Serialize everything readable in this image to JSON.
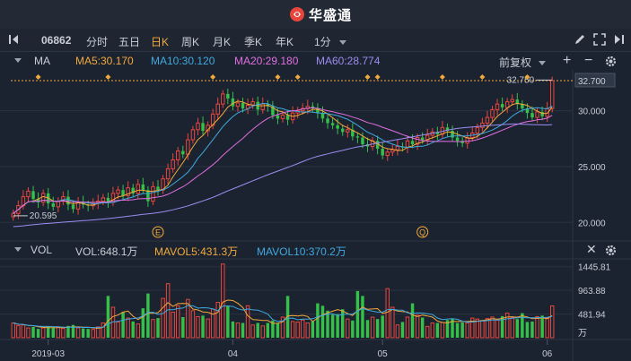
{
  "app": {
    "logo_text": "华盛通"
  },
  "toolbar": {
    "stock_code": "06862",
    "tabs": [
      "分时",
      "五日",
      "日K",
      "周K",
      "月K",
      "季K",
      "年K"
    ],
    "active_tab": "日K",
    "interval": "1分"
  },
  "ma_panel": {
    "title": "MA",
    "ma5": "MA5:30.170",
    "ma10": "MA10:30.120",
    "ma20": "MA20:29.180",
    "ma60": "MA60:28.774",
    "adjust": "前复权",
    "price_axis": [
      "32.700",
      "30.000",
      "25.000",
      "20.000"
    ],
    "high_label": "32.750",
    "low_label": "20.595",
    "event_markers": [
      "E",
      "Q"
    ]
  },
  "vol_panel": {
    "title": "VOL",
    "vol": "VOL:648.1万",
    "mavol5": "MAVOL5:431.3万",
    "mavol10": "MAVOL10:370.2万",
    "axis": [
      "1445.81",
      "963.88",
      "481.94",
      "万"
    ]
  },
  "time_axis": [
    "2019-03",
    "04",
    "05",
    "06"
  ],
  "colors": {
    "up": "#e8463d",
    "down": "#35c04a",
    "ma5": "#f2a93b",
    "ma10": "#3fa9e0",
    "ma20": "#e06ee0",
    "ma60": "#9b8cf0",
    "accent": "#f2a93b"
  },
  "chart_data": {
    "type": "candlestick",
    "price_range": [
      18.5,
      33.5
    ],
    "vol_range": [
      0,
      1550
    ],
    "close": [
      20.8,
      21.5,
      22.3,
      22.8,
      22.1,
      21.8,
      22.6,
      21.7,
      21.4,
      21.9,
      22.3,
      21.6,
      21.2,
      21.8,
      21.6,
      21.5,
      21.7,
      21.9,
      22.2,
      21.8,
      22.6,
      22.9,
      22.4,
      23.1,
      22.6,
      23.4,
      22.9,
      21.9,
      23.2,
      22.9,
      23.9,
      24.8,
      25.6,
      26.4,
      26.1,
      27.4,
      28.3,
      28.9,
      28.2,
      28.7,
      29.7,
      30.6,
      31.5,
      31.1,
      30.4,
      30.7,
      30.2,
      30.5,
      30.8,
      30.1,
      30.6,
      30.4,
      29.6,
      29.3,
      29.6,
      29.2,
      29.8,
      30.0,
      30.2,
      30.4,
      30.2,
      29.8,
      29.3,
      28.9,
      28.7,
      28.4,
      28.1,
      28.3,
      27.7,
      27.6,
      27.0,
      26.8,
      27.3,
      26.6,
      26.0,
      26.3,
      26.5,
      26.8,
      26.7,
      27.3,
      27.0,
      27.6,
      27.4,
      27.8,
      28.1,
      27.9,
      28.5,
      28.2,
      27.6,
      27.3,
      27.1,
      27.6,
      28.0,
      28.5,
      28.9,
      29.4,
      30.1,
      30.6,
      30.3,
      30.8,
      31.0,
      30.6,
      30.2,
      29.8,
      29.4,
      29.9,
      29.5,
      30.2,
      32.7
    ],
    "vol": [
      300,
      250,
      260,
      200,
      220,
      180,
      200,
      230,
      200,
      210,
      190,
      240,
      260,
      200,
      190,
      180,
      170,
      220,
      300,
      850,
      620,
      320,
      520,
      400,
      330,
      280,
      600,
      900,
      370,
      400,
      800,
      1100,
      520,
      650,
      420,
      780,
      550,
      430,
      450,
      380,
      580,
      720,
      1500,
      650,
      330,
      300,
      300,
      650,
      260,
      300,
      240,
      300,
      350,
      300,
      420,
      850,
      330,
      320,
      360,
      300,
      330,
      700,
      650,
      550,
      470,
      480,
      580,
      380,
      350,
      950,
      850,
      360,
      420,
      380,
      450,
      1000,
      620,
      260,
      320,
      420,
      700,
      460,
      410,
      230,
      300,
      300,
      310,
      360,
      380,
      300,
      310,
      300,
      400,
      380,
      350,
      390,
      420,
      360,
      440,
      500,
      410,
      380,
      500,
      320,
      330,
      430,
      450,
      400,
      648
    ]
  }
}
